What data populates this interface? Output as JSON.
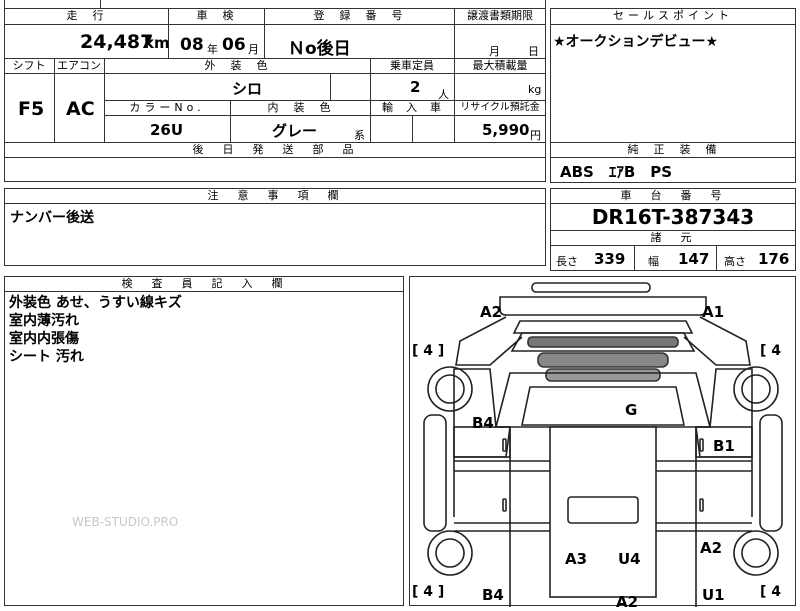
{
  "top_table": {
    "headers": {
      "mileage": "走　行",
      "inspection": "車　検",
      "registration": "登　録　番　号",
      "transfer_deadline": "譲渡書類期限",
      "shift": "シフト",
      "aircon": "エアコン",
      "exterior_color": "外　装　色",
      "capacity": "乗車定員",
      "max_load": "最大積載量",
      "color_no": "カラーNo.",
      "interior_color": "内　装　色",
      "import": "輸　入　車",
      "recycle": "リサイクル預託金",
      "later_parts": "後　日　発　送　部　品"
    },
    "mileage_value": "24,487",
    "mileage_unit": "km",
    "inspection_year": "08",
    "inspection_year_unit": "年",
    "inspection_month": "06",
    "inspection_month_unit": "月",
    "registration_value": "Ｎo後日",
    "transfer_month_unit": "月",
    "transfer_day_unit": "日",
    "shift_value": "F5",
    "aircon_value": "AC",
    "exterior_color_value": "シロ",
    "capacity_value": "2",
    "capacity_unit": "人",
    "max_load_unit": "kg",
    "color_no_value": "26U",
    "interior_color_value": "グレー",
    "interior_color_suffix": "系",
    "recycle_value": "5,990",
    "recycle_unit": "円"
  },
  "sales_point": {
    "header": "セールスポイント",
    "text": "★オークションデビュー★"
  },
  "standard_equipment": {
    "header": "純　正　装　備",
    "text": "ABS　ｴｱB　PS"
  },
  "notes": {
    "header": "注　意　事　項　欄",
    "text": "ナンバー後送"
  },
  "chassis": {
    "header": "車　台　番　号",
    "value": "DR16T-387343",
    "spec_header": "諸　元",
    "length_label": "長さ",
    "length_value": "339",
    "width_label": "幅",
    "width_value": "147",
    "height_label": "高さ",
    "height_value": "176"
  },
  "inspector": {
    "header": "検　査　員　記　入　欄",
    "lines": [
      "外装色 あせ、うすい線キズ",
      "室内薄汚れ",
      "室内内張傷",
      "シート 汚れ"
    ]
  },
  "diagram": {
    "marks": {
      "a2_top_left": "A2",
      "a1_top_right": "A1",
      "g_roof": "G",
      "b4_left": "B4",
      "b1_right": "B1",
      "a3_bed": "A3",
      "u4_bed": "U4",
      "a2_right_lower": "A2",
      "b4_bottom_left": "B4",
      "a2_bottom_center": "A2",
      "u1_bottom_right": "U1"
    },
    "tire_top_left": "[ 4 ]",
    "tire_top_right": "[ 4",
    "tire_bottom_left": "[ 4 ]",
    "tire_bottom_right": "[ 4"
  },
  "watermark": "WEB-STUDIO.PRO"
}
